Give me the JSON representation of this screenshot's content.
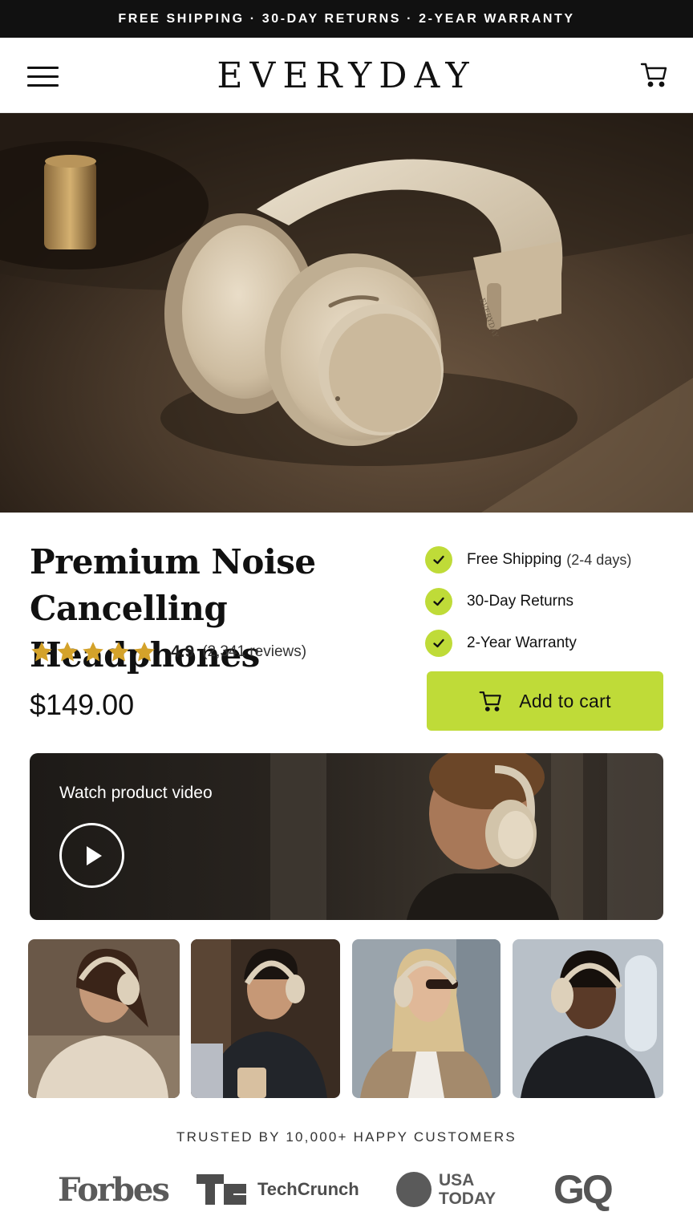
{
  "announcement": "FREE SHIPPING · 30-DAY RETURNS · 2-YEAR WARRANTY",
  "brand": "EVERYDAY",
  "hero": {
    "image_icon": "headphones-hero-image",
    "product_engraving": "EVERYDAY"
  },
  "product": {
    "title": "Premium Noise Cancelling Headphones",
    "rating": "4.9",
    "reviews": "(2,341 reviews)",
    "stars": 5,
    "price": "$149.00"
  },
  "perks": [
    {
      "label": "Free Shipping",
      "extra": "(2-4 days)"
    },
    {
      "label": "30-Day Returns",
      "extra": ""
    },
    {
      "label": "2-Year Warranty",
      "extra": ""
    }
  ],
  "cta": {
    "label": "Add to cart"
  },
  "video": {
    "label": "Watch product video"
  },
  "thumbnails": [
    "woman-relaxing-photo",
    "man-with-laptop-photo",
    "woman-sunglasses-photo",
    "man-on-train-photo"
  ],
  "trust": {
    "heading": "TRUSTED BY 10,000+ HAPPY CUSTOMERS",
    "logos": {
      "forbes": "Forbes",
      "techcrunch": "TechCrunch",
      "usa_today_1": "USA",
      "usa_today_2": "TODAY",
      "gq": "GQ"
    }
  },
  "colors": {
    "accent": "#bfdb38",
    "star": "#d4a22a",
    "dark": "#111111"
  }
}
